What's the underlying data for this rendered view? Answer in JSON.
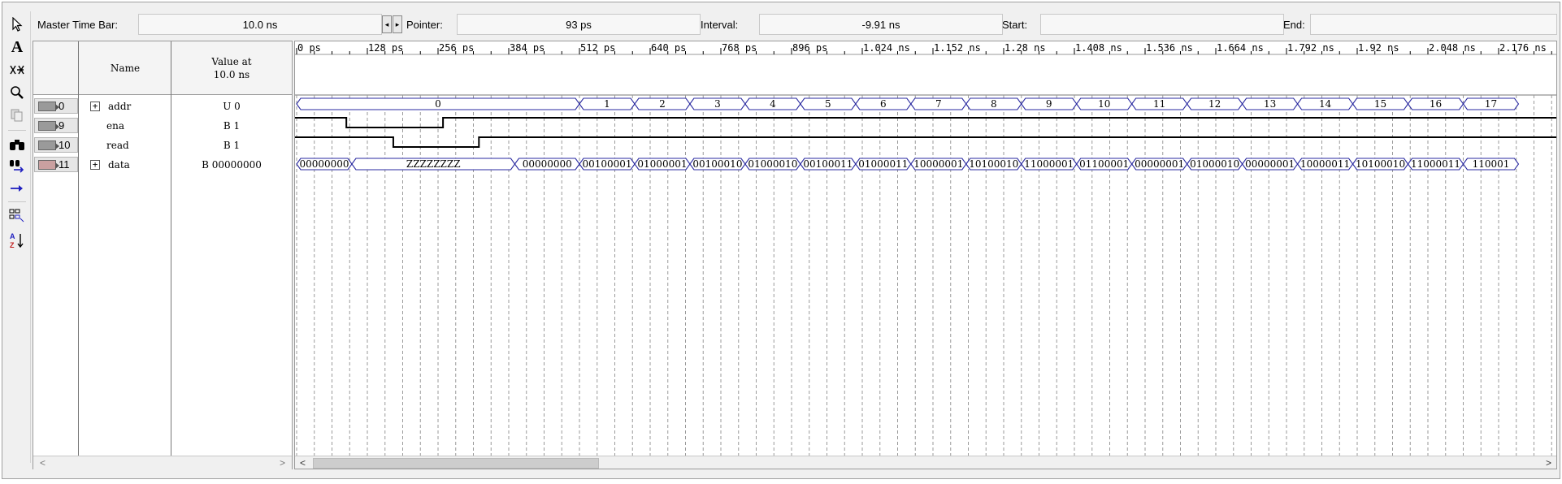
{
  "infobar": {
    "master_label": "Master Time Bar:",
    "master_value": "10.0 ns",
    "pointer_label": "Pointer:",
    "pointer_value": "93 ps",
    "interval_label": "Interval:",
    "interval_value": "-9.91 ns",
    "start_label": "Start:",
    "start_value": "",
    "end_label": "End:",
    "end_value": ""
  },
  "toolbar": {
    "icons": [
      "pointer-icon",
      "text-tool-icon",
      "waveform-editing-icon",
      "zoom-icon",
      "copy-icon",
      "find-icon",
      "replace-icon",
      "goto-icon",
      "group-icon",
      "sort-icon"
    ]
  },
  "node_table": {
    "name_header": "Name",
    "value_header_line1": "Value at",
    "value_header_line2": "10.0 ns",
    "rows": [
      {
        "id": "0",
        "name": "addr",
        "value": "U 0",
        "expandable": true
      },
      {
        "id": "9",
        "name": "ena",
        "value": "B 1",
        "expandable": false
      },
      {
        "id": "10",
        "name": "read",
        "value": "B 1",
        "expandable": false
      },
      {
        "id": "11",
        "name": "data",
        "value": "B 00000000",
        "expandable": true
      }
    ]
  },
  "timeline": {
    "ticks": [
      "0 ps",
      "128 ps",
      "256 ps",
      "384 ps",
      "512 ps",
      "640 ps",
      "768 ps",
      "896 ps",
      "1.024 ns",
      "1.152 ns",
      "1.28 ns",
      "1.408 ns",
      "1.536 ns",
      "1.664 ns",
      "1.792 ns",
      "1.92 ns",
      "2.048 ns",
      "2.176 ns"
    ]
  },
  "waveforms": {
    "addr_values": [
      "0",
      "1",
      "2",
      "3",
      "4",
      "5",
      "6",
      "7",
      "8",
      "9",
      "10",
      "11",
      "12",
      "13",
      "14",
      "15",
      "16",
      "17"
    ],
    "data_values": [
      "00000000",
      "ZZZZZZZZ",
      "00000000",
      "00100001",
      "01000001",
      "00100010",
      "01000010",
      "00100011",
      "01000011",
      "10000001",
      "10100010",
      "11000001",
      "01100001",
      "00000001",
      "01000010",
      "00000001",
      "10000011",
      "10100010",
      "11000011",
      "110001"
    ],
    "ena_transitions_ps": [
      90,
      265
    ],
    "read_transitions_ps": [
      175,
      330
    ]
  },
  "colors": {
    "bus_outline": "#2a2aa0",
    "signal_line": "#000000",
    "grid": "#9a9a9a"
  }
}
